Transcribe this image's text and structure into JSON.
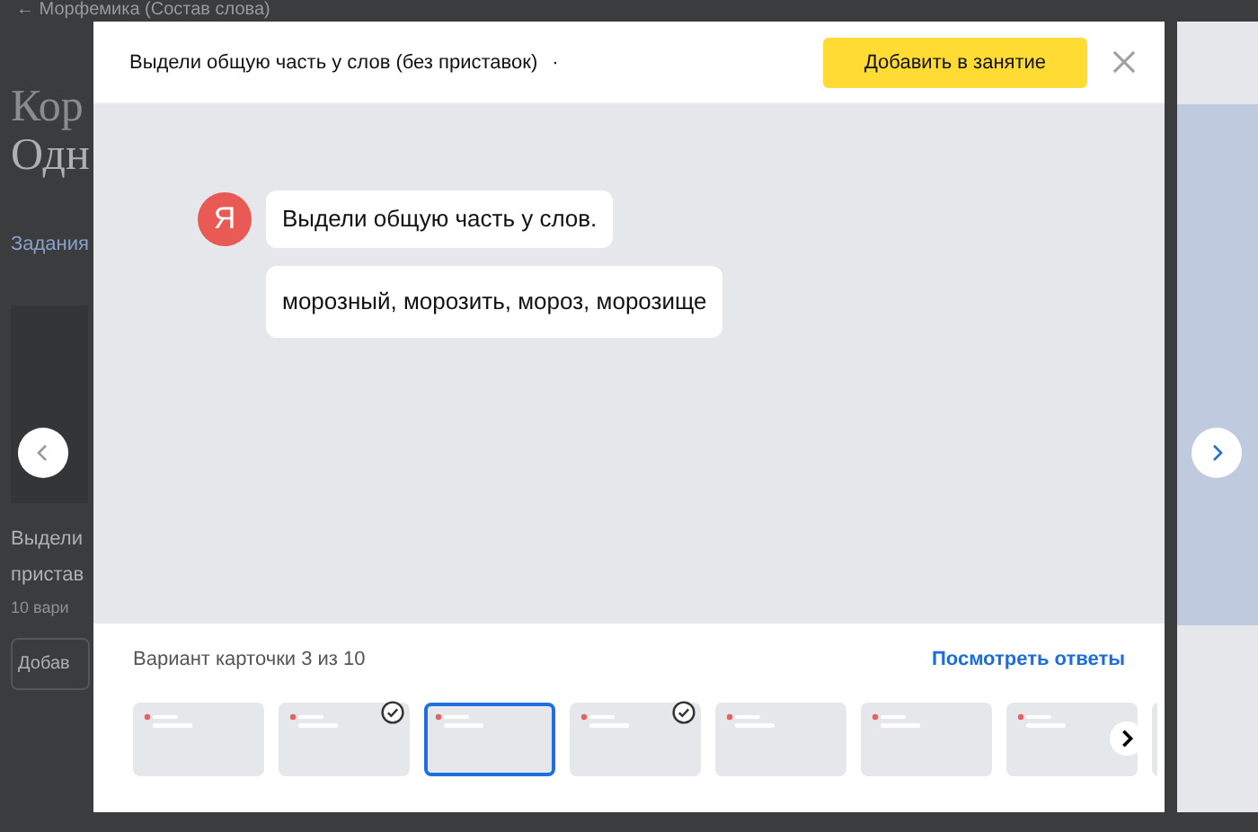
{
  "background_page": {
    "breadcrumb": "← Морфемика (Состав слова)",
    "heading_lines": [
      "Кор",
      "Одн"
    ],
    "tab": "Задания",
    "card_title_lines": [
      "Выдели",
      "пристав"
    ],
    "card_subtitle": "10 вари",
    "card_button": "Добав"
  },
  "modal": {
    "title": "Выдели общую часть у слов (без приставок)",
    "title_separator": "·",
    "add_button": "Добавить в занятие",
    "chat": {
      "avatar_letter": "Я",
      "messages": [
        {
          "kind": "bot",
          "text": "Выдели общую часть у слов."
        },
        {
          "kind": "plain",
          "text": "морозный, морозить, мороз, морозище"
        }
      ]
    },
    "variant_label": "Вариант карточки 3 из 10",
    "answers_link": "Посмотреть ответы",
    "thumbnails": [
      {
        "selected": false,
        "checked": false
      },
      {
        "selected": false,
        "checked": true
      },
      {
        "selected": true,
        "checked": false
      },
      {
        "selected": false,
        "checked": true
      },
      {
        "selected": false,
        "checked": false
      },
      {
        "selected": false,
        "checked": false
      },
      {
        "selected": false,
        "checked": false
      },
      {
        "selected": false
      }
    ]
  }
}
